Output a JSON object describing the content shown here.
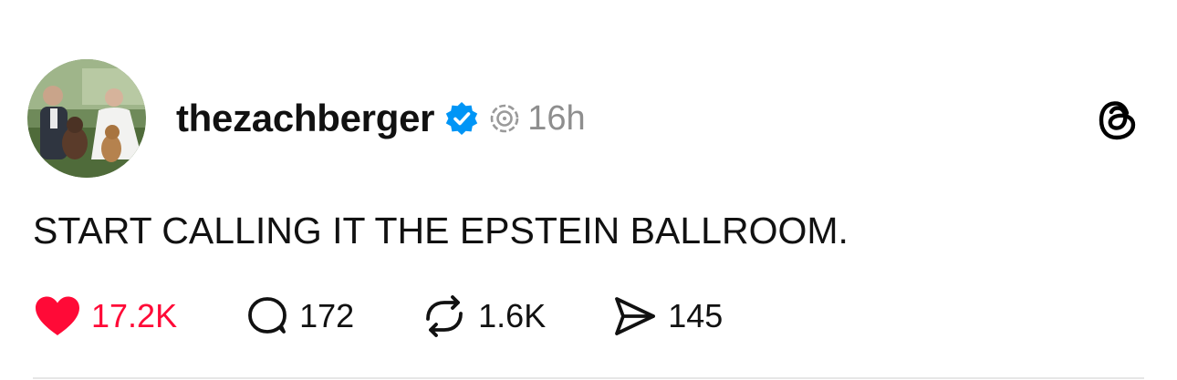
{
  "post": {
    "username": "thezachberger",
    "verified": true,
    "time": "16h",
    "text": "START CALLING IT THE EPSTEIN BALLROOM.",
    "app_icon": "threads-logo-icon"
  },
  "actions": {
    "likes": {
      "icon": "heart-filled-icon",
      "count": "17.2K",
      "liked": true
    },
    "replies": {
      "icon": "comment-bubble-icon",
      "count": "172"
    },
    "reposts": {
      "icon": "repost-icon",
      "count": "1.6K"
    },
    "shares": {
      "icon": "send-icon",
      "count": "145"
    }
  },
  "colors": {
    "like_red": "#ff0a37",
    "verified_blue": "#0095f6",
    "muted_text": "#8e8e8e",
    "text": "#111111"
  }
}
